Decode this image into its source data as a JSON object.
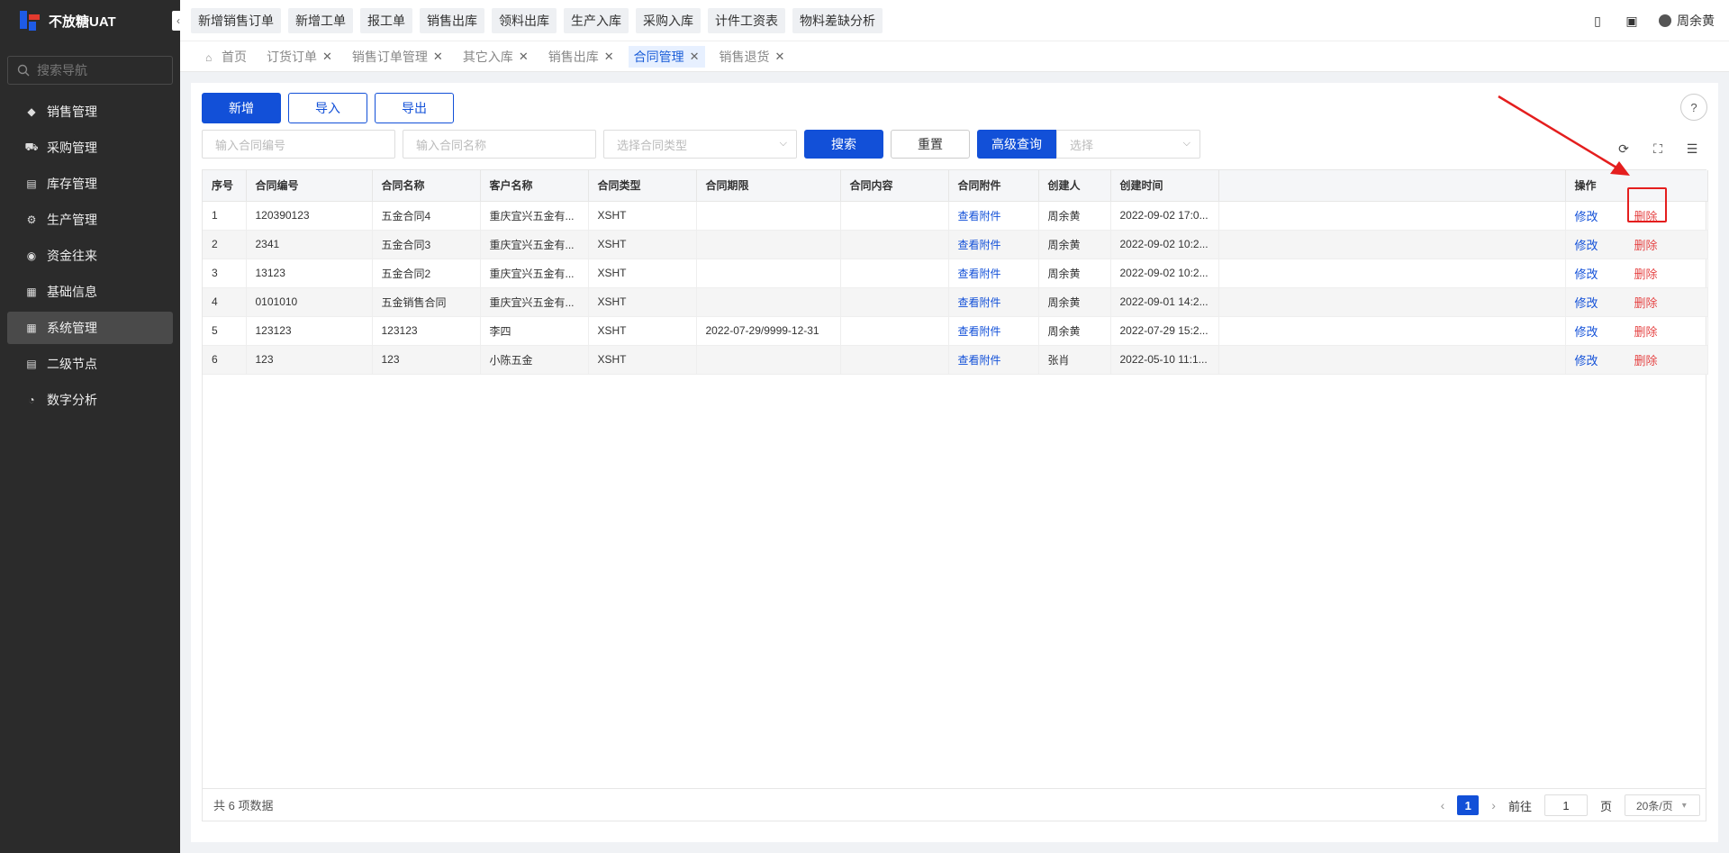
{
  "app": {
    "title": "不放糖UAT"
  },
  "sidebar": {
    "search_placeholder": "搜索导航",
    "items": [
      {
        "label": "销售管理",
        "icon": "tag-icon"
      },
      {
        "label": "采购管理",
        "icon": "cart-icon"
      },
      {
        "label": "库存管理",
        "icon": "inventory-icon"
      },
      {
        "label": "生产管理",
        "icon": "production-icon"
      },
      {
        "label": "资金往来",
        "icon": "funds-icon"
      },
      {
        "label": "基础信息",
        "icon": "info-icon"
      },
      {
        "label": "系统管理",
        "icon": "grid-icon",
        "active": true
      },
      {
        "label": "二级节点",
        "icon": "doc-icon"
      },
      {
        "label": "数字分析",
        "icon": "pie-icon"
      }
    ]
  },
  "topbar": {
    "quick": [
      "新增销售订单",
      "新增工单",
      "报工单",
      "销售出库",
      "领料出库",
      "生产入库",
      "采购入库",
      "计件工资表",
      "物料差缺分析"
    ],
    "user": "周余黄"
  },
  "tabs": [
    {
      "label": "首页",
      "closable": false
    },
    {
      "label": "订货订单",
      "closable": true
    },
    {
      "label": "销售订单管理",
      "closable": true
    },
    {
      "label": "其它入库",
      "closable": true
    },
    {
      "label": "销售出库",
      "closable": true
    },
    {
      "label": "合同管理",
      "closable": true,
      "active": true
    },
    {
      "label": "销售退货",
      "closable": true
    }
  ],
  "actions": {
    "add": "新增",
    "import": "导入",
    "export": "导出"
  },
  "filters": {
    "contract_no_placeholder": "输入合同编号",
    "contract_name_placeholder": "输入合同名称",
    "contract_type_placeholder": "选择合同类型",
    "search": "搜索",
    "reset": "重置",
    "advanced": "高级查询",
    "advanced_select_placeholder": "选择"
  },
  "table": {
    "columns": [
      "序号",
      "合同编号",
      "合同名称",
      "客户名称",
      "合同类型",
      "合同期限",
      "合同内容",
      "合同附件",
      "创建人",
      "创建时间",
      "",
      "操作"
    ],
    "rows": [
      [
        "1",
        "120390123",
        "五金合同4",
        "重庆宜兴五金有...",
        "XSHT",
        "",
        "",
        "查看附件",
        "周余黄",
        "2022-09-02 17:0..."
      ],
      [
        "2",
        "2341",
        "五金合同3",
        "重庆宜兴五金有...",
        "XSHT",
        "",
        "",
        "查看附件",
        "周余黄",
        "2022-09-02 10:2..."
      ],
      [
        "3",
        "13123",
        "五金合同2",
        "重庆宜兴五金有...",
        "XSHT",
        "",
        "",
        "查看附件",
        "周余黄",
        "2022-09-02 10:2..."
      ],
      [
        "4",
        "0101010",
        "五金销售合同",
        "重庆宜兴五金有...",
        "XSHT",
        "",
        "",
        "查看附件",
        "周余黄",
        "2022-09-01 14:2..."
      ],
      [
        "5",
        "123123",
        "123123",
        "李四",
        "XSHT",
        "2022-07-29/9999-12-31",
        "",
        "查看附件",
        "周余黄",
        "2022-07-29 15:2..."
      ],
      [
        "6",
        "123",
        "123",
        "小陈五金",
        "XSHT",
        "",
        "",
        "查看附件",
        "张肖",
        "2022-05-10 11:1..."
      ]
    ],
    "edit_label": "修改",
    "delete_label": "删除"
  },
  "pagination": {
    "total_text": "共 6 项数据",
    "current_page": "1",
    "goto_prefix": "前往",
    "goto_value": "1",
    "goto_suffix": "页",
    "page_size": "20条/页"
  },
  "colors": {
    "primary": "#1250d8",
    "danger": "#e54545",
    "sidebar": "#2b2b2b",
    "annotation": "#e41e1e"
  }
}
